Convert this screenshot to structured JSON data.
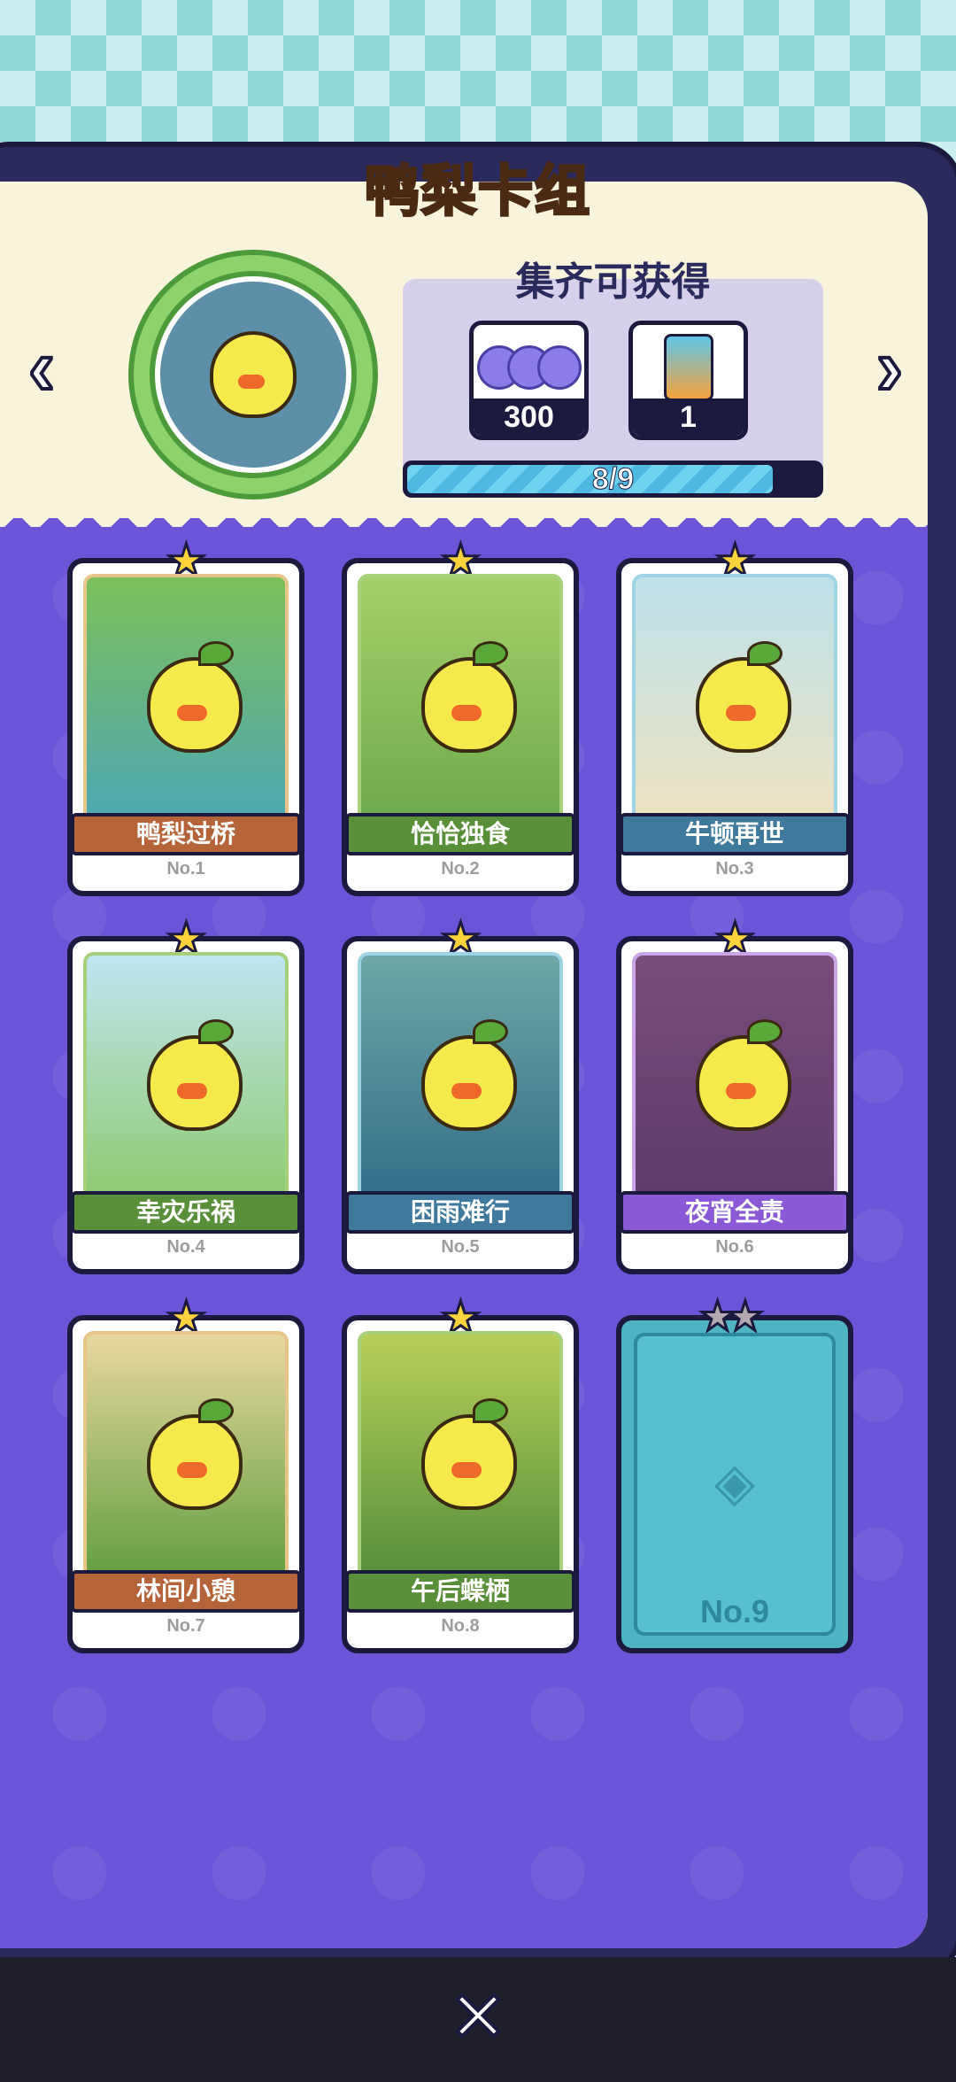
{
  "header": {
    "title": "鸭梨卡组"
  },
  "nav": {
    "prev_icon": "chevron-left-icon",
    "next_icon": "chevron-right-icon"
  },
  "rewards": {
    "title": "集齐可获得",
    "items": [
      {
        "icon": "coin-stack-icon",
        "count": "300"
      },
      {
        "icon": "ticket-icon",
        "count": "1"
      }
    ],
    "progress_text": "8/9",
    "progress_fraction": 0.889
  },
  "cards": [
    {
      "title": "鸭梨过桥",
      "no": "No.1"
    },
    {
      "title": "恰恰独食",
      "no": "No.2"
    },
    {
      "title": "牛顿再世",
      "no": "No.3"
    },
    {
      "title": "幸灾乐祸",
      "no": "No.4"
    },
    {
      "title": "困雨难行",
      "no": "No.5"
    },
    {
      "title": "夜宵全责",
      "no": "No.6"
    },
    {
      "title": "林间小憩",
      "no": "No.7"
    },
    {
      "title": "午后蝶栖",
      "no": "No.8"
    },
    {
      "title": "",
      "no": "No.9",
      "locked": true
    }
  ],
  "colors": {
    "ribbon_brown": "#b5643a",
    "ribbon_green": "#5a8f3a",
    "ribbon_blue": "#3f7a9e",
    "ribbon_purple": "#8a5ad6",
    "panel_purple": "#6c54d8"
  },
  "footer": {
    "close_icon": "close-icon"
  }
}
